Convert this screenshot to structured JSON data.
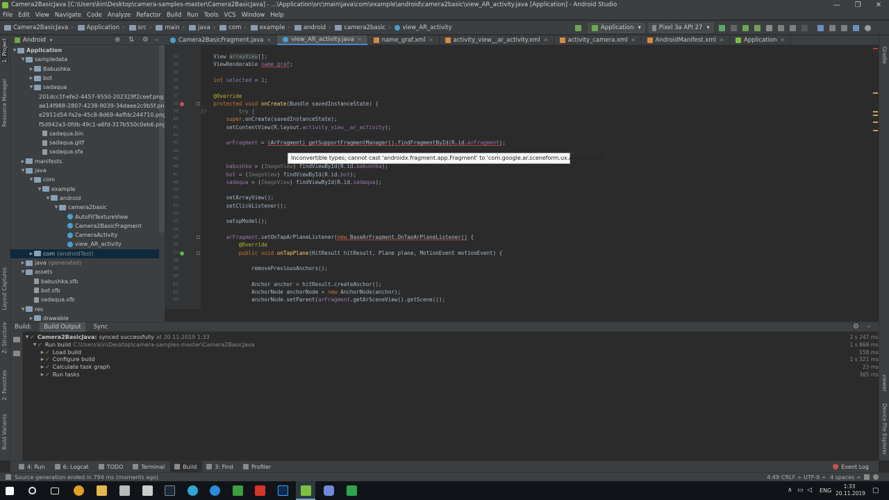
{
  "window": {
    "title": "Camera2BasicJava [C:\\Users\\kin\\Desktop\\camera-samples-master\\Camera2BasicJava] - ...\\Application\\src\\main\\java\\com\\example\\android\\camera2basic\\view_AR_activity.java [Application] - Android Studio",
    "minimize": "—",
    "maximize": "❐",
    "close": "✕"
  },
  "menu": [
    "File",
    "Edit",
    "View",
    "Navigate",
    "Code",
    "Analyze",
    "Refactor",
    "Build",
    "Run",
    "Tools",
    "VCS",
    "Window",
    "Help"
  ],
  "breadcrumbs": [
    "Camera2BasicJava",
    "Application",
    "src",
    "main",
    "java",
    "com",
    "example",
    "android",
    "camera2basic",
    "view_AR_activity"
  ],
  "toolbar": {
    "run_config": "Application",
    "device": "Pixel 3a API 27"
  },
  "project_panel": {
    "view_mode": "Android",
    "tree": [
      {
        "label": "Application",
        "depth": 0,
        "icon": "folder",
        "expanded": true,
        "bold": true
      },
      {
        "label": "sampledata",
        "depth": 1,
        "icon": "folder",
        "expanded": true
      },
      {
        "label": "Babushka",
        "depth": 2,
        "icon": "folder",
        "expanded": false
      },
      {
        "label": "bot",
        "depth": 2,
        "icon": "folder",
        "expanded": false
      },
      {
        "label": "sadaqua",
        "depth": 2,
        "icon": "folder",
        "expanded": true
      },
      {
        "label": "201dcc1f-efe2-4457-9550-202329f2ceef.png",
        "depth": 3,
        "icon": "img"
      },
      {
        "label": "ae14f988-2807-4238-9039-34daee2c9b5f.png",
        "depth": 3,
        "icon": "img"
      },
      {
        "label": "e2911d54-fa2e-45c8-8d69-4affdc244710.png",
        "depth": 3,
        "icon": "img"
      },
      {
        "label": "f5d942a3-0fdb-49c1-a6fd-317b550c0eb6.png",
        "depth": 3,
        "icon": "img"
      },
      {
        "label": "sadaqua.bin",
        "depth": 3,
        "icon": "file"
      },
      {
        "label": "sadaqua.gltf",
        "depth": 3,
        "icon": "file"
      },
      {
        "label": "sadaqua.sfa",
        "depth": 3,
        "icon": "file"
      },
      {
        "label": "manifests",
        "depth": 1,
        "icon": "folder",
        "expanded": false
      },
      {
        "label": "java",
        "depth": 1,
        "icon": "folder",
        "expanded": true
      },
      {
        "label": "com",
        "depth": 2,
        "icon": "folder",
        "expanded": true
      },
      {
        "label": "example",
        "depth": 3,
        "icon": "folder",
        "expanded": true
      },
      {
        "label": "android",
        "depth": 4,
        "icon": "folder",
        "expanded": true
      },
      {
        "label": "camera2basic",
        "depth": 5,
        "icon": "folder",
        "expanded": true
      },
      {
        "label": "AutoFitTextureView",
        "depth": 6,
        "icon": "java"
      },
      {
        "label": "Camera2BasicFragment",
        "depth": 6,
        "icon": "java"
      },
      {
        "label": "CameraActivity",
        "depth": 6,
        "icon": "java"
      },
      {
        "label": "view_AR_activity",
        "depth": 6,
        "icon": "java"
      },
      {
        "label": "com",
        "suffix": "(androidTest)",
        "depth": 2,
        "icon": "folder",
        "expanded": false,
        "selected": true
      },
      {
        "label": "java",
        "suffix": "(generated)",
        "depth": 1,
        "icon": "folder",
        "expanded": false
      },
      {
        "label": "assets",
        "depth": 1,
        "icon": "folder",
        "expanded": true
      },
      {
        "label": "babushka.sfb",
        "depth": 2,
        "icon": "file"
      },
      {
        "label": "bot.sfb",
        "depth": 2,
        "icon": "file"
      },
      {
        "label": "sadaqua.sfb",
        "depth": 2,
        "icon": "file"
      },
      {
        "label": "res",
        "depth": 1,
        "icon": "folder",
        "expanded": true
      },
      {
        "label": "drawable",
        "depth": 2,
        "icon": "folder",
        "expanded": false
      }
    ]
  },
  "left_strip": [
    "1: Project",
    "Resource Manager",
    "Layout Captures",
    "Z: Structure",
    "2: Favorites",
    "Build Variants"
  ],
  "right_strip": [
    "Gradle",
    "viewer",
    "Device File Explorer"
  ],
  "tabs": [
    {
      "label": "Camera2BasicFragment.java",
      "type": "java",
      "active": false
    },
    {
      "label": "view_AR_activity.java",
      "type": "java",
      "active": true
    },
    {
      "label": "name_graf.xml",
      "type": "xml",
      "active": false
    },
    {
      "label": "activity_view__ar_activity.xml",
      "type": "xml",
      "active": false
    },
    {
      "label": "activity_camera.xml",
      "type": "xml",
      "active": false
    },
    {
      "label": "AndroidManifest.xml",
      "type": "xml",
      "active": false
    },
    {
      "label": "Application",
      "type": "app",
      "active": false
    }
  ],
  "code_lines": [
    {
      "n": "32",
      "html_key": "l32"
    },
    {
      "n": "33",
      "html_key": "l33"
    },
    {
      "n": "34",
      "html_key": "l34"
    },
    {
      "n": "35",
      "html_key": "l35"
    },
    {
      "n": "36",
      "html_key": "l36"
    },
    {
      "n": "37",
      "html_key": "l37"
    },
    {
      "n": "38",
      "html_key": "l38"
    },
    {
      "n": "39",
      "html_key": "l39"
    },
    {
      "n": "40",
      "html_key": "l40"
    },
    {
      "n": "41",
      "html_key": "l41"
    },
    {
      "n": "42",
      "html_key": "l42"
    },
    {
      "n": "43",
      "html_key": "l43"
    },
    {
      "n": "44",
      "html_key": "l44"
    },
    {
      "n": "45",
      "html_key": "l45"
    },
    {
      "n": "46",
      "html_key": "l46"
    },
    {
      "n": "47",
      "html_key": "l47"
    },
    {
      "n": "48",
      "html_key": "l48"
    },
    {
      "n": "49",
      "html_key": "l49"
    },
    {
      "n": "50",
      "html_key": "l50"
    },
    {
      "n": "51",
      "html_key": "l51"
    },
    {
      "n": "52",
      "html_key": "l52"
    },
    {
      "n": "53",
      "html_key": "l53"
    },
    {
      "n": "54",
      "html_key": "l54"
    },
    {
      "n": "55",
      "html_key": "l55"
    },
    {
      "n": "56",
      "html_key": "l56"
    },
    {
      "n": "57",
      "html_key": "l57"
    },
    {
      "n": "58",
      "html_key": "l58"
    },
    {
      "n": "59",
      "html_key": "l59"
    },
    {
      "n": "60",
      "html_key": "l60"
    },
    {
      "n": "61",
      "html_key": "l61"
    },
    {
      "n": "62",
      "html_key": "l62"
    },
    {
      "n": "63",
      "html_key": "l63"
    }
  ],
  "code": {
    "l32": [
      [
        "",
        "    View "
      ],
      [
        "fld hl",
        "arrayView"
      ],
      [
        "",
        "[];"
      ]
    ],
    "l33": [
      [
        "",
        "    ViewRenderable "
      ],
      [
        "fld ul",
        "name_graf"
      ],
      [
        "",
        ";"
      ]
    ],
    "l34": [],
    "l35": [
      [
        "kw",
        "    int "
      ],
      [
        "fld",
        "selected"
      ],
      [
        "",
        " = "
      ],
      [
        "num",
        "1"
      ],
      [
        "",
        ";"
      ]
    ],
    "l36": [],
    "l37": [
      [
        "ann",
        "    @Override"
      ]
    ],
    "l38": [
      [
        "kw",
        "    protected void "
      ],
      [
        "mth",
        "onCreate"
      ],
      [
        "",
        "(Bundle savedInstanceState) {"
      ]
    ],
    "l39": [
      [
        "cmt",
        "//          try {"
      ]
    ],
    "l40": [
      [
        "kw",
        "        super"
      ],
      [
        "",
        ".onCreate(savedInstanceState);"
      ]
    ],
    "l41": [
      [
        "",
        "        setContentView(R.layout."
      ],
      [
        "fld",
        "activity_view__ar_activity"
      ],
      [
        "",
        ");"
      ]
    ],
    "l42": [],
    "l43": [
      [
        "fld",
        "        arFragment"
      ],
      [
        "",
        " = "
      ],
      [
        "ul",
        "(ArFragment) getSupportFragmentManager().findFragmentById(R.id."
      ],
      [
        "fld ul",
        "arFragment"
      ],
      [
        "ul",
        ")"
      ],
      [
        "",
        ";"
      ]
    ],
    "l44": [],
    "l45": [],
    "l46": [
      [
        "fld",
        "        babushka"
      ],
      [
        "",
        " = ("
      ],
      [
        "grey",
        "ImageView"
      ],
      [
        "",
        ") findViewById(R.id."
      ],
      [
        "fld",
        "babushka"
      ],
      [
        "",
        ");"
      ]
    ],
    "l47": [
      [
        "fld",
        "        bot"
      ],
      [
        "",
        " = ("
      ],
      [
        "grey",
        "ImageView"
      ],
      [
        "",
        ") findViewById(R.id."
      ],
      [
        "fld",
        "bot"
      ],
      [
        "",
        ");"
      ]
    ],
    "l48": [
      [
        "fld",
        "        sadaqua"
      ],
      [
        "",
        " = ("
      ],
      [
        "grey",
        "ImageView"
      ],
      [
        "",
        ") findViewById(R.id."
      ],
      [
        "fld",
        "sadaqua"
      ],
      [
        "",
        ");"
      ]
    ],
    "l49": [],
    "l50": [
      [
        "",
        "        setArrayView();"
      ]
    ],
    "l51": [
      [
        "",
        "        setClickListener();"
      ]
    ],
    "l52": [],
    "l53": [
      [
        "",
        "        setupModel();"
      ]
    ],
    "l54": [],
    "l55": [
      [
        "fld",
        "        arFragment"
      ],
      [
        "",
        ".setOnTapArPlaneListener("
      ],
      [
        "kw ul",
        "new "
      ],
      [
        "ul",
        "BaseArFragment.OnTapArPlaneListener()"
      ],
      [
        "",
        " {"
      ]
    ],
    "l56": [
      [
        "ann",
        "            @Override"
      ]
    ],
    "l57": [
      [
        "kw",
        "            public void "
      ],
      [
        "mth",
        "onTapPlane"
      ],
      [
        "",
        "(HitResult hitResult, Plane plane, MotionEvent motionEvent) {"
      ]
    ],
    "l58": [],
    "l59": [
      [
        "",
        "                removePreviousAnchors();"
      ]
    ],
    "l60": [],
    "l61": [
      [
        "",
        "                Anchor anchor = hitResult.createAnchor();"
      ]
    ],
    "l62": [
      [
        "",
        "                AnchorNode anchorNode = "
      ],
      [
        "kw",
        "new "
      ],
      [
        "",
        "AnchorNode(anchor);"
      ]
    ],
    "l63": [
      [
        "",
        "                anchorNode.setParent("
      ],
      [
        "fld",
        "arFragment"
      ],
      [
        "",
        ".getArSceneView().getScene());"
      ]
    ]
  },
  "tooltip": "Inconvertible types; cannot cast 'androidx.fragment.app.Fragment' to 'com.google.ar.sceneform.ux.ArFragment'",
  "build": {
    "tabs": [
      "Build:",
      "Build Output",
      "Sync"
    ],
    "items": [
      {
        "depth": 0,
        "label": "Camera2BasicJava:",
        "detail": "synced successfully",
        "extra": "at 20.11.2019 1:33",
        "time": "2 s 247 ms",
        "bold": true
      },
      {
        "depth": 1,
        "label": "Run build",
        "extra": "C:\\Users\\kin\\Desktop\\camera-samples-master\\Camera2BasicJava",
        "time": "1 s 868 ms"
      },
      {
        "depth": 2,
        "label": "Load build",
        "time": "158 ms"
      },
      {
        "depth": 2,
        "label": "Configure build",
        "time": "1 s 321 ms"
      },
      {
        "depth": 2,
        "label": "Calculate task graph",
        "time": "23 ms"
      },
      {
        "depth": 2,
        "label": "Run tasks",
        "time": "365 ms"
      }
    ]
  },
  "bottom_tools": [
    {
      "label": "4: Run",
      "active": false
    },
    {
      "label": "6: Logcat",
      "active": false
    },
    {
      "label": "TODO",
      "active": false
    },
    {
      "label": "Terminal",
      "active": false
    },
    {
      "label": "Build",
      "active": true
    },
    {
      "label": "3: Find",
      "active": false
    },
    {
      "label": "Profiler",
      "active": false
    }
  ],
  "event_log": "Event Log",
  "status": {
    "message": "Source generation ended in 794 ms (moments ago)",
    "position": "4:49",
    "line_sep": "CRLF ÷",
    "encoding": "UTF-8 ÷",
    "indent": "4 spaces ÷"
  },
  "taskbar": {
    "lang": "ENG",
    "time": "1:33",
    "date": "20.11.2019"
  }
}
